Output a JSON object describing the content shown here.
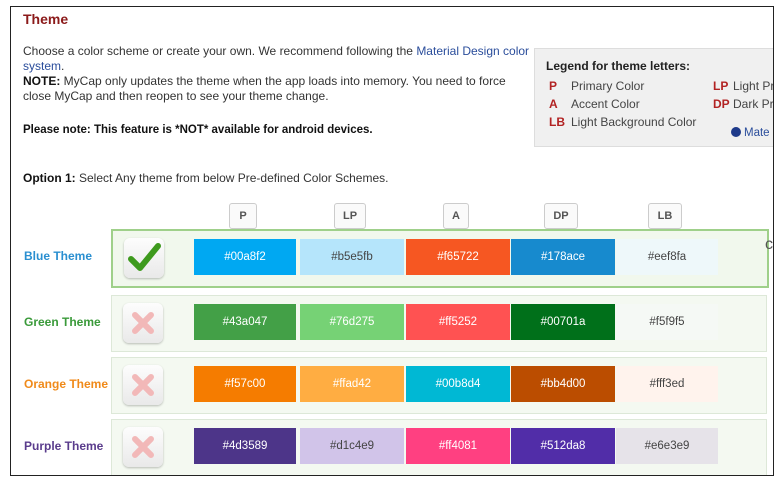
{
  "page": {
    "title": "Theme",
    "intro_text_1": "Choose a color scheme or create your own. We recommend following the ",
    "intro_link": "Material Design color system",
    "intro_text_1b": ".",
    "note_label": "NOTE:",
    "note_text": " MyCap only updates the theme when the app loads into memory. You need to force close MyCap and then reopen to see your theme change.",
    "please_note": "Please note: This feature is *NOT* available for android devices.",
    "option1_label": "Option 1:",
    "option1_text": " Select Any theme from below Pre-defined Color Schemes."
  },
  "legend": {
    "title": "Legend for theme letters:",
    "items": [
      {
        "key": "P",
        "label": "Primary Color"
      },
      {
        "key": "A",
        "label": "Accent Color"
      },
      {
        "key": "LB",
        "label": "Light Background Color"
      },
      {
        "key": "LP",
        "label": "Light Prin"
      },
      {
        "key": "DP",
        "label": "Dark Prin"
      }
    ],
    "more_link": "Mate"
  },
  "columns": [
    "P",
    "LP",
    "A",
    "DP",
    "LB"
  ],
  "themes": [
    {
      "name": "Blue Theme",
      "name_color": "#2a8fd0",
      "selected": true,
      "swatches": [
        {
          "hex": "#00a8f2"
        },
        {
          "hex": "#b5e5fb"
        },
        {
          "hex": "#f65722"
        },
        {
          "hex": "#178ace"
        },
        {
          "hex": "#eef8fa"
        }
      ]
    },
    {
      "name": "Green Theme",
      "name_color": "#3a9a3a",
      "selected": false,
      "swatches": [
        {
          "hex": "#43a047"
        },
        {
          "hex": "#76d275"
        },
        {
          "hex": "#ff5252"
        },
        {
          "hex": "#00701a"
        },
        {
          "hex": "#f5f9f5"
        }
      ]
    },
    {
      "name": "Orange Theme",
      "name_color": "#f08a1a",
      "selected": false,
      "swatches": [
        {
          "hex": "#f57c00"
        },
        {
          "hex": "#ffad42"
        },
        {
          "hex": "#00b8d4"
        },
        {
          "hex": "#bb4d00"
        },
        {
          "hex": "#fff3ed"
        }
      ]
    },
    {
      "name": "Purple Theme",
      "name_color": "#5a3c8c",
      "selected": false,
      "swatches": [
        {
          "hex": "#4d3589"
        },
        {
          "hex": "#d1c4e9"
        },
        {
          "hex": "#ff4081"
        },
        {
          "hex": "#512da8"
        },
        {
          "hex": "#e6e3e9"
        }
      ]
    }
  ]
}
